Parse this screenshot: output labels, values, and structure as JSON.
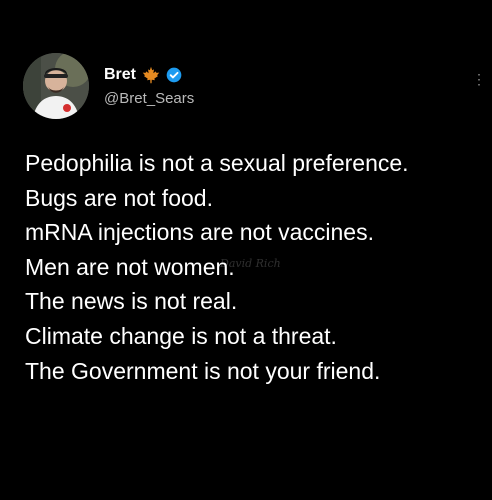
{
  "tweet": {
    "author": {
      "name": "Bret",
      "handle": "@Bret_Sears",
      "badges": [
        "maple-leaf-icon",
        "verified-badge-icon"
      ]
    },
    "lines": [
      "Pedophilia is not a sexual preference.",
      "Bugs are not food.",
      "mRNA injections are not vaccines.",
      "Men are not women.",
      "The news is not real.",
      "Climate change is not a threat.",
      "The Government is not your friend."
    ],
    "watermark": "David Rich"
  },
  "colors": {
    "background": "#000000",
    "text": "#ffffff",
    "handle": "#b9b9b9",
    "verified": "#1d9bf0",
    "maple": "#e58a21"
  }
}
